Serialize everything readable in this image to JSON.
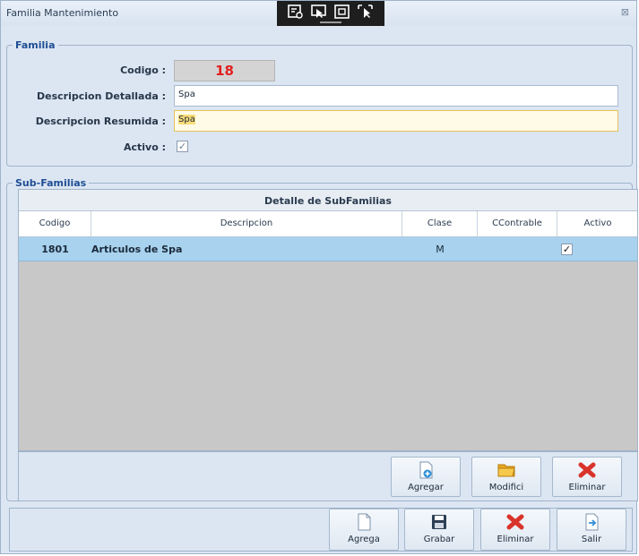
{
  "window": {
    "title": "Familia Mantenimiento",
    "close_glyph": "⊠"
  },
  "overlay_toolbar": {
    "icons": [
      "screen-capture-icon",
      "pointer-icon",
      "frame-icon",
      "cursor-selection-icon"
    ]
  },
  "familia": {
    "legend": "Familia",
    "codigo_label": "Codigo :",
    "codigo_value": "18",
    "desc_detallada_label": "Descripcion Detallada :",
    "desc_detallada_value": "Spa",
    "desc_resumida_label": "Descripcion Resumida :",
    "desc_resumida_value": "Spa",
    "activo_label": "Activo :",
    "activo_checked": true,
    "check_glyph": "✓"
  },
  "subfamilias": {
    "legend": "Sub-Familias",
    "grid_caption": "Detalle de SubFamilias",
    "columns": [
      "Codigo",
      "Descripcion",
      "Clase",
      "CContrable",
      "Activo"
    ],
    "rows": [
      {
        "codigo": "1801",
        "descripcion": "Articulos de Spa",
        "clase": "M",
        "ccontrable": "",
        "activo": "✓"
      }
    ],
    "buttons": {
      "agregar": "Agregar",
      "modificar": "Modifici",
      "eliminar": "Eliminar"
    }
  },
  "main_buttons": {
    "agrega": "Agrega",
    "grabar": "Grabar",
    "eliminar": "Eliminar",
    "salir": "Salir"
  },
  "colors": {
    "accent": "#1f4e94",
    "codigo_text": "#e31e1e",
    "selected_row": "#a8d2ee",
    "window_bg": "#dce6f2",
    "delete_icon": "#d9342b",
    "folder_icon": "#f0b429"
  }
}
